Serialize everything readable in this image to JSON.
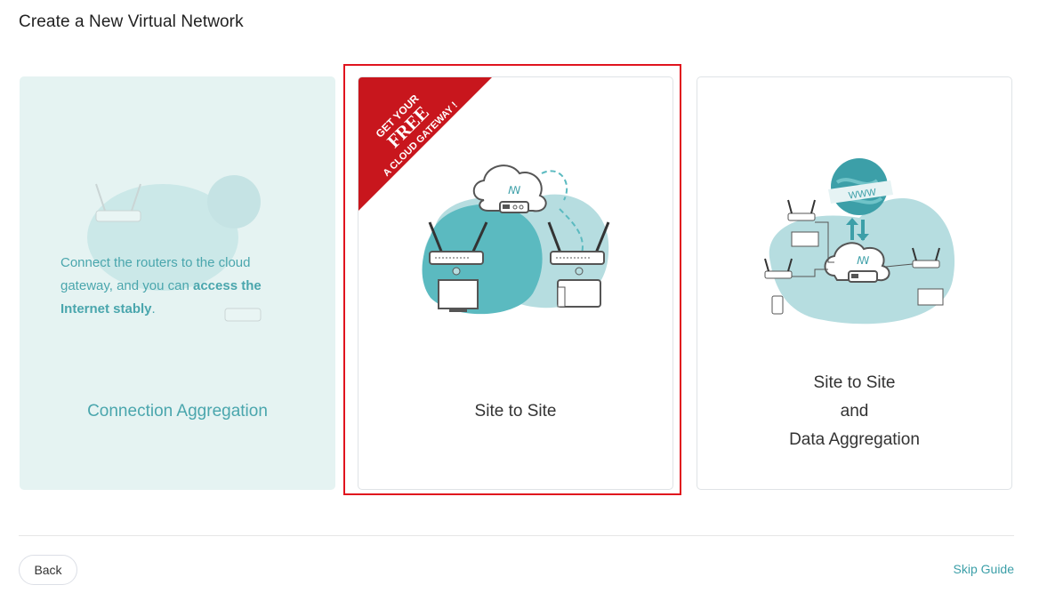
{
  "page": {
    "title": "Create a New Virtual Network"
  },
  "cards": [
    {
      "id": "connection-aggregation",
      "label": "Connection Aggregation",
      "description_parts": [
        "Connect the routers to the cloud gateway, and you can ",
        "access the Internet stably",
        "."
      ]
    },
    {
      "id": "site-to-site",
      "label": "Site to Site",
      "ribbon": [
        "GET YOUR",
        "FREE",
        "A CLOUD GATEWAY !"
      ],
      "selected": true
    },
    {
      "id": "site-to-site-data-aggregation",
      "label_lines": [
        "Site to Site",
        "and",
        "Data Aggregation"
      ]
    }
  ],
  "illustration": {
    "globe_text": "WWW"
  },
  "footer": {
    "back_label": "Back",
    "skip_label": "Skip Guide"
  },
  "colors": {
    "accent": "#3c9fa8",
    "selected_border": "#e0141e",
    "ribbon": "#c8161d",
    "blob": "#5bbac0",
    "blob_light": "#b6dde0"
  }
}
